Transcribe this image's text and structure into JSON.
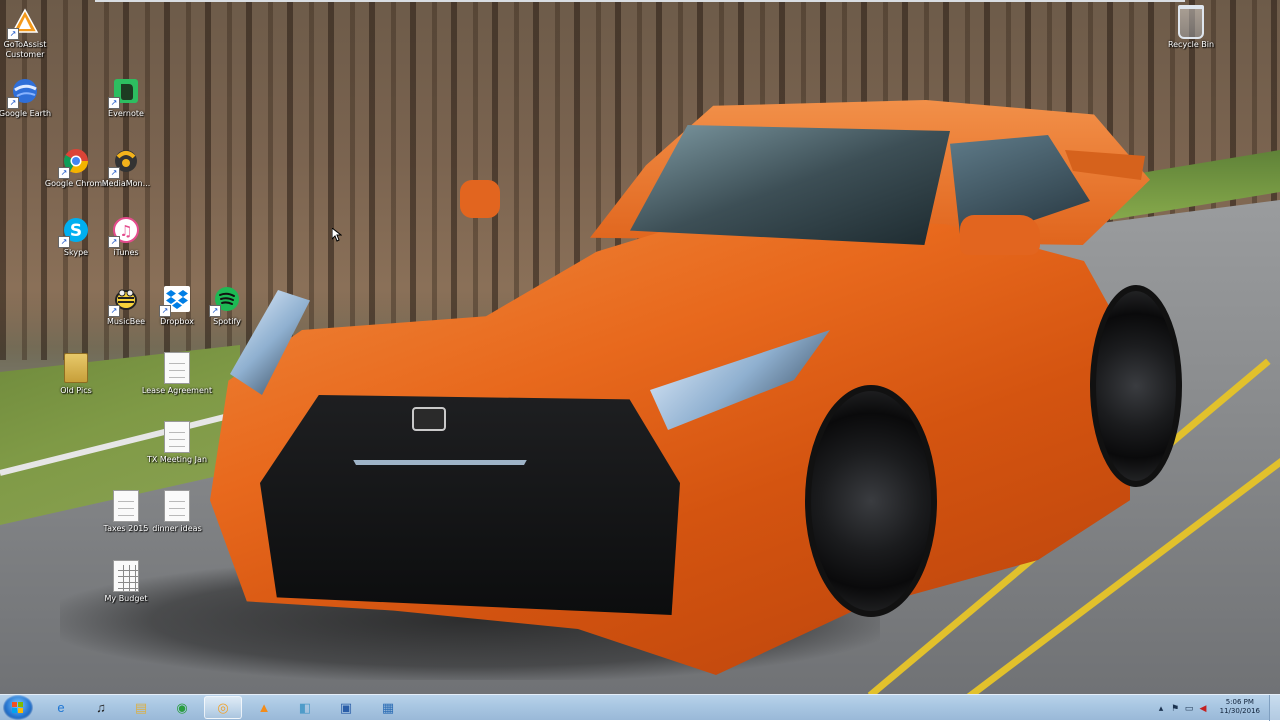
{
  "desktop": {
    "icons": [
      {
        "label": "GoToAssist Customer",
        "icon": "gotoassist-icon"
      },
      {
        "label": "Google Earth",
        "icon": "google-earth-icon"
      },
      {
        "label": "Evernote",
        "icon": "evernote-icon"
      },
      {
        "label": "Google Chrome",
        "icon": "chrome-icon"
      },
      {
        "label": "MediaMon...",
        "icon": "mediamonkey-icon"
      },
      {
        "label": "Skype",
        "icon": "skype-icon"
      },
      {
        "label": "iTunes",
        "icon": "itunes-icon"
      },
      {
        "label": "MusicBee",
        "icon": "musicbee-icon"
      },
      {
        "label": "Dropbox",
        "icon": "dropbox-icon"
      },
      {
        "label": "Spotify",
        "icon": "spotify-icon"
      },
      {
        "label": "Old Pics",
        "icon": "folder-icon"
      },
      {
        "label": "Lease Agreement",
        "icon": "document-icon"
      },
      {
        "label": "TX Meeting Jan",
        "icon": "document-icon"
      },
      {
        "label": "Taxes 2015",
        "icon": "document-icon"
      },
      {
        "label": "dinner ideas",
        "icon": "document-icon"
      },
      {
        "label": "My Budget",
        "icon": "spreadsheet-icon"
      },
      {
        "label": "Recycle Bin",
        "icon": "recycle-bin-icon"
      }
    ]
  },
  "taskbar": {
    "pinned": [
      {
        "icon": "internet-explorer-icon",
        "glyph": "e",
        "color": "#1f76d3"
      },
      {
        "icon": "musicbee-icon",
        "glyph": "♫",
        "color": "#222222"
      },
      {
        "icon": "file-explorer-icon",
        "glyph": "▤",
        "color": "#d9b04a"
      },
      {
        "icon": "chrome-icon",
        "glyph": "◉",
        "color": "#2a9d3f"
      },
      {
        "icon": "gotomeeting-icon",
        "glyph": "◎",
        "color": "#f0a12a"
      },
      {
        "icon": "gotoassist-icon",
        "glyph": "▲",
        "color": "#f28c1a"
      },
      {
        "icon": "remote-desktop-icon",
        "glyph": "◧",
        "color": "#4f9cc9"
      },
      {
        "icon": "network-tool-icon",
        "glyph": "▣",
        "color": "#2b5ea8"
      },
      {
        "icon": "system-tool-icon",
        "glyph": "▦",
        "color": "#2c6db5"
      }
    ],
    "tray": {
      "time": "5:06 PM",
      "date": "11/30/2016"
    }
  },
  "colors": {
    "taskbar": "#a8c6e2",
    "car": "#e8691d",
    "road_line": "#e2c12c"
  }
}
